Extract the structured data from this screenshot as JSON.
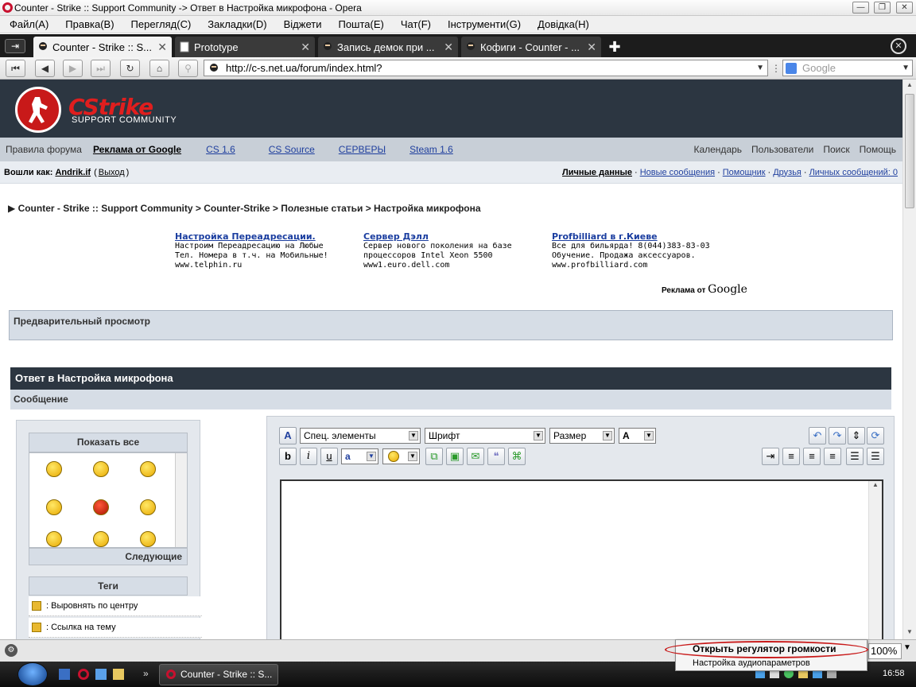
{
  "window": {
    "title": "Counter - Strike :: Support Community -> Ответ в Настройка микрофона - Opera"
  },
  "menu": [
    "Файл(A)",
    "Правка(B)",
    "Перегляд(C)",
    "Закладки(D)",
    "Віджети",
    "Пошта(E)",
    "Чат(F)",
    "Інструменти(G)",
    "Довідка(H)"
  ],
  "tabs": [
    {
      "label": "Counter - Strike :: S..."
    },
    {
      "label": "Prototype"
    },
    {
      "label": "Запись демок при ..."
    },
    {
      "label": "Кофиги - Counter - ..."
    }
  ],
  "address": {
    "url": "http://c-s.net.ua/forum/index.html?",
    "search_placeholder": "Google"
  },
  "site": {
    "logo_text": "CStrike",
    "logo_sub": "SUPPORT COMMUNITY",
    "nav_left": [
      "Правила форума",
      "Реклама от Google",
      "CS 1.6",
      "CS Source",
      "СЕРВЕРЫ",
      "Steam 1.6"
    ],
    "nav_right": [
      "Календарь",
      "Пользователи",
      "Поиск",
      "Помощь"
    ],
    "logged_as": "Вошли как:",
    "user": "Andrik.if",
    "logout": "Выход",
    "user_links": [
      "Личные данные",
      "Новые сообщения",
      "Помощник",
      "Друзья",
      "Личных сообщений: 0"
    ],
    "breadcrumb": "▶ Counter - Strike :: Support Community > Counter-Strike > Полезные статьи > Настройка микрофона",
    "ads": [
      {
        "title": "Настройка Переадресации.",
        "l1": "Настроим Переадресацию на Любые",
        "l2": "Тел. Номера в т.ч. на Мобильные!",
        "l3": "www.telphin.ru"
      },
      {
        "title": "Сервер Дэлл",
        "l1": "Сервер нового поколения на базе",
        "l2": "процессоров Intel Xeon 5500",
        "l3": "www1.euro.dell.com"
      },
      {
        "title": "Profbilliard в г.Киеве",
        "l1": "Все для бильярда! 8(044)383-83-03",
        "l2": "Обучение. Продажа аксессуаров.",
        "l3": "www.profbilliard.com"
      }
    ],
    "ads_by": "Реклама от",
    "ads_google": "Google",
    "preview_head": "Предварительный просмотр",
    "reply_head": "Ответ в Настройка микрофона",
    "message_head": "Сообщение",
    "show_all": "Показать все",
    "next": "Следующие",
    "tags_head": "Теги",
    "tags": [
      ": Выровнять по центру",
      ": Ссылка на тему"
    ],
    "editor": {
      "special": "Спец. элементы",
      "font": "Шрифт",
      "size": "Размер",
      "bold": "b",
      "italic": "i",
      "underline": "u"
    }
  },
  "status": {
    "zoom": "100%",
    "clock": "16:58"
  },
  "context_menu": [
    "Открыть регулятор громкости",
    "Настройка аудиопараметров"
  ],
  "taskbar": {
    "window": "Counter - Strike :: S..."
  },
  "colors": {
    "header": "#2c3641",
    "nav": "#c8cfd7",
    "link": "#1f3f9e",
    "accent": "#c81919"
  }
}
